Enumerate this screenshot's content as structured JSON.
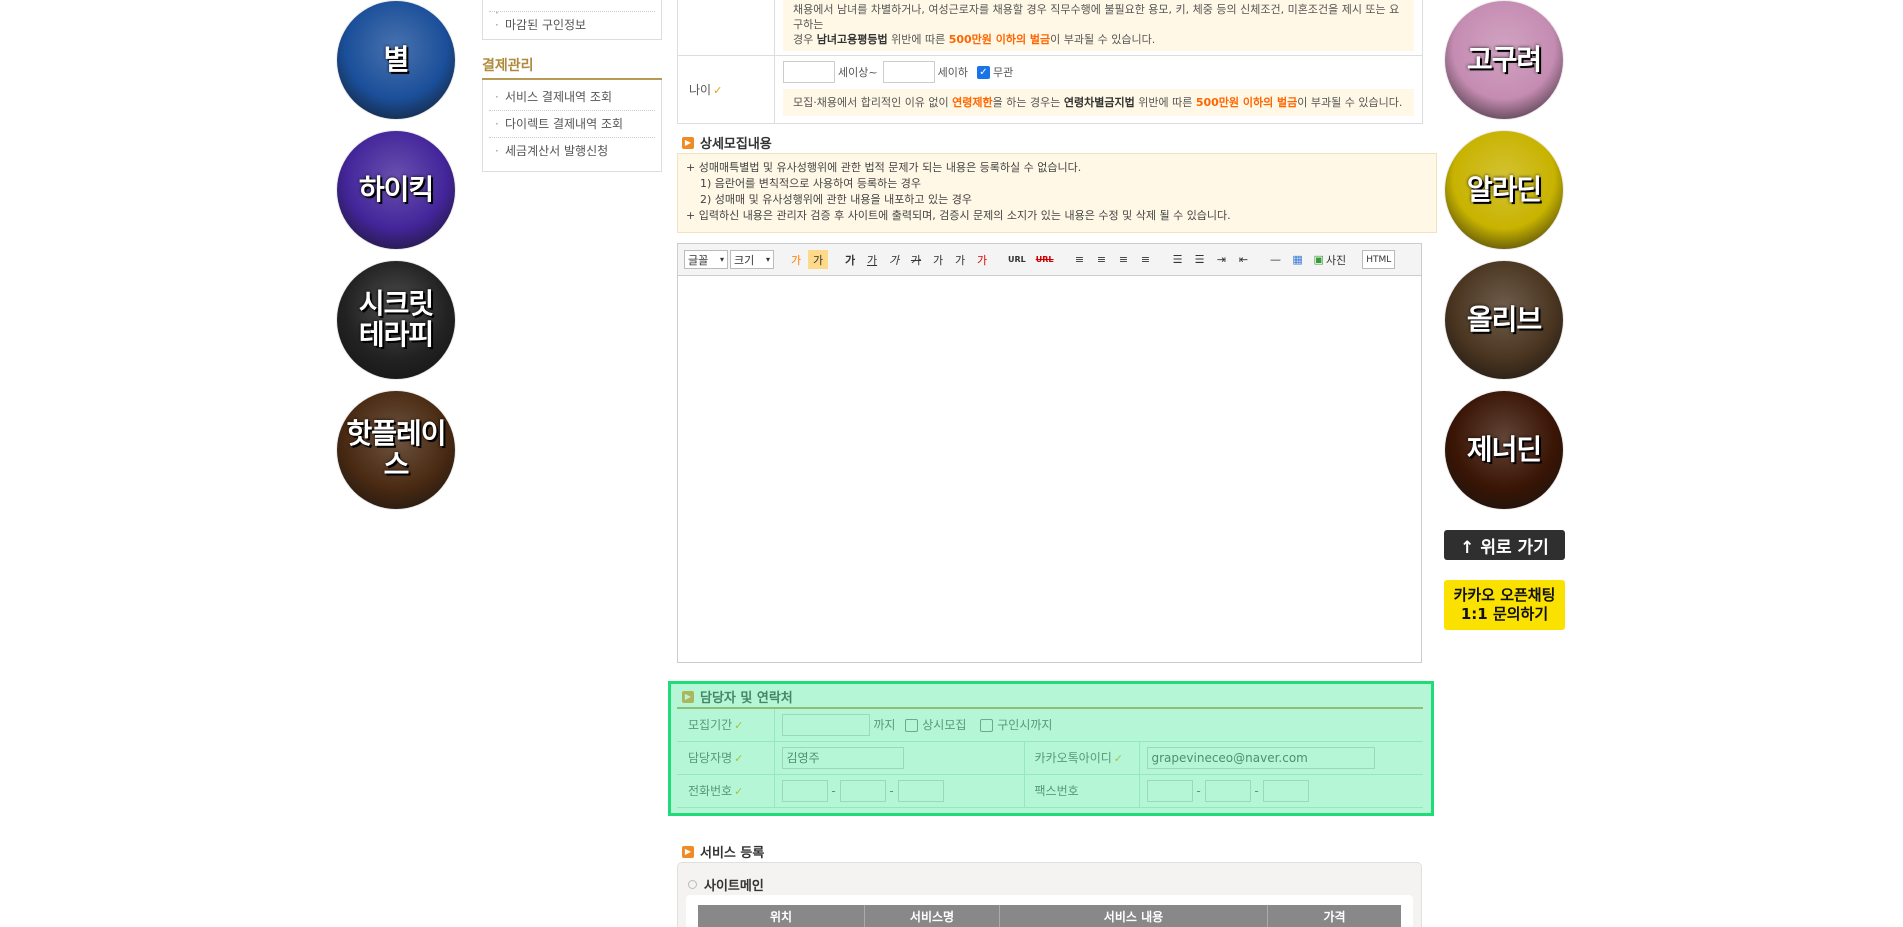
{
  "left_banners": [
    {
      "label": "별",
      "color": "#1b4f9a"
    },
    {
      "label": "하이킥",
      "color": "#43259a"
    },
    {
      "label": "시크릿\n테라피",
      "color": "#222222"
    },
    {
      "label": "핫플레이스",
      "color": "#4a2a12"
    }
  ],
  "right_banners": [
    {
      "label": "고구려",
      "color": "#c58cb2"
    },
    {
      "label": "알라딘",
      "color": "#c8b300"
    },
    {
      "label": "올리브",
      "color": "#4a3520"
    },
    {
      "label": "제너딘",
      "color": "#3a1505"
    }
  ],
  "top_button": "↑ 위로 가기",
  "kakao_button": "카카오 오픈채팅\n1:1 문의하기",
  "left_menu": {
    "items_top": [
      "마감된 구인정보"
    ],
    "section_title": "결제관리",
    "section_items": [
      "서비스 결제내역 조회",
      "다이렉트 결제내역 조회",
      "세금계산서 발행신청"
    ]
  },
  "age": {
    "label": "나이",
    "suffix_min": "세이상~",
    "suffix_max": "세이하",
    "nolimit_label": "무관",
    "warn_prefix": "모집·채용에서 합리적인 이유 없이 ",
    "warn_em1": "연령제한",
    "warn_mid": "을 하는 경우는 ",
    "warn_law": "연령차별금지법",
    "warn_mid2": " 위반에 따른 ",
    "warn_em2": "500만원 이하의 벌금",
    "warn_suffix": "이 부과될 수 있습니다."
  },
  "gender_warn": {
    "line1": "채용에서 남녀를 차별하거나, 여성근로자를 채용할 경우 직무수행에 불필요한 용모, 키, 체중 등의 신체조건, 미혼조건을 제시 또는 요구하는",
    "line2_prefix": "경우 ",
    "line2_law": "남녀고용평등법",
    "line2_mid": " 위반에 따른 ",
    "line2_em": "500만원 이하의 벌금",
    "line2_suffix": "이 부과될 수 있습니다."
  },
  "detail": {
    "title": "상세모집내용",
    "notice": [
      "+ 성매매특별법 및 유사성행위에 관한 법적 문제가 되는 내용은 등록하실 수 없습니다.",
      "1) 음란어를 변칙적으로 사용하여 등록하는 경우",
      "2) 성매매 및 유사성행위에 관한 내용을 내포하고 있는 경우",
      "+ 입력하신 내용은 관리자 검증 후 사이트에 출력되며, 검증시 문제의 소지가 있는 내용은 수정 및 삭제 될 수 있습니다."
    ]
  },
  "editor": {
    "font_label": "글꼴",
    "size_label": "크기",
    "tools": [
      "가",
      "가",
      "가",
      "가",
      "가",
      "가",
      "가",
      "가",
      "가",
      "URL",
      "URL"
    ],
    "photo_label": "사진",
    "html_label": "HTML"
  },
  "contact": {
    "title": "담당자 및 연락처",
    "period_label": "모집기간",
    "period_until": "까지",
    "always_label": "상시모집",
    "until_hired_label": "구인시까지",
    "manager_label": "담당자명",
    "manager_value": "김영주",
    "kakao_label": "카카오톡아이디",
    "kakao_value": "grapevineceo@naver.com",
    "phone_label": "전화번호",
    "fax_label": "팩스번호",
    "dash": "-"
  },
  "service": {
    "title": "서비스 등록",
    "subtitle": "사이트메인",
    "columns": [
      "위치",
      "서비스명",
      "서비스 내용",
      "가격"
    ]
  }
}
